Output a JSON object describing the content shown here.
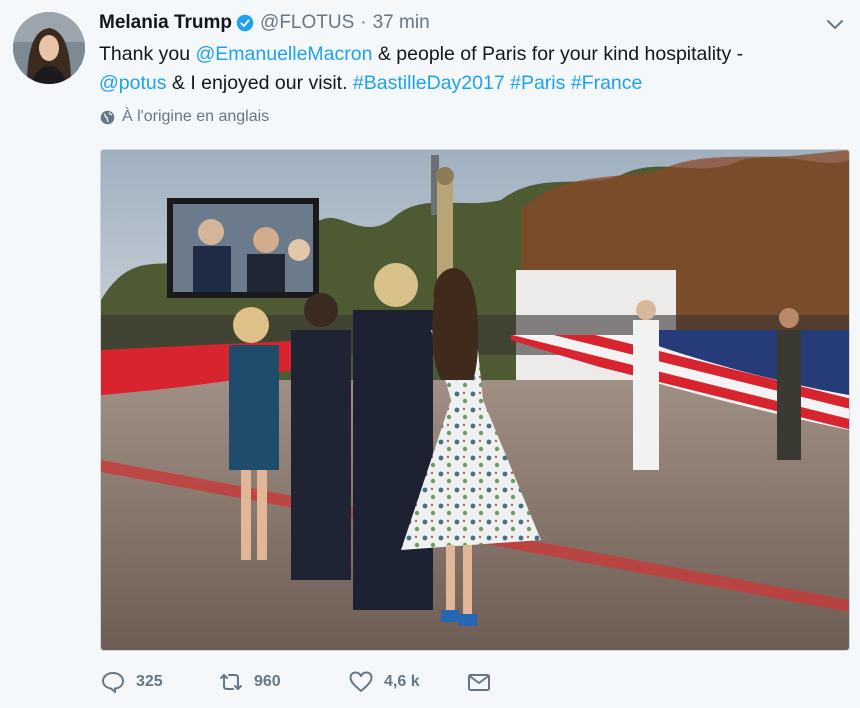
{
  "tweet": {
    "author_name": "Melania Trump",
    "handle": "@FLOTUS",
    "separator": "·",
    "time": "37 min",
    "text_parts": [
      {
        "text": "Thank you ",
        "link": false
      },
      {
        "text": "@EmanuelleMacron",
        "link": true
      },
      {
        "text": " & people of Paris for your kind hospitality - ",
        "link": false
      },
      {
        "text": "@potus",
        "link": true
      },
      {
        "text": " & I enjoyed our visit. ",
        "link": false
      },
      {
        "text": "#BastilleDay2017",
        "link": true
      },
      {
        "text": " ",
        "link": false
      },
      {
        "text": "#Paris",
        "link": true
      },
      {
        "text": " ",
        "link": false
      },
      {
        "text": "#France",
        "link": true
      }
    ],
    "translate_label": "À l'origine en anglais",
    "actions": {
      "reply_count": "325",
      "retweet_count": "960",
      "like_count": "4,6 k"
    }
  },
  "colors": {
    "link": "#1da1f2",
    "muted": "#657786",
    "verified": "#1da1f2",
    "background": "#f5f8fa"
  },
  "icons": [
    "verified-badge-icon",
    "chevron-down-icon",
    "globe-icon",
    "reply-icon",
    "retweet-icon",
    "like-icon",
    "direct-message-icon"
  ]
}
